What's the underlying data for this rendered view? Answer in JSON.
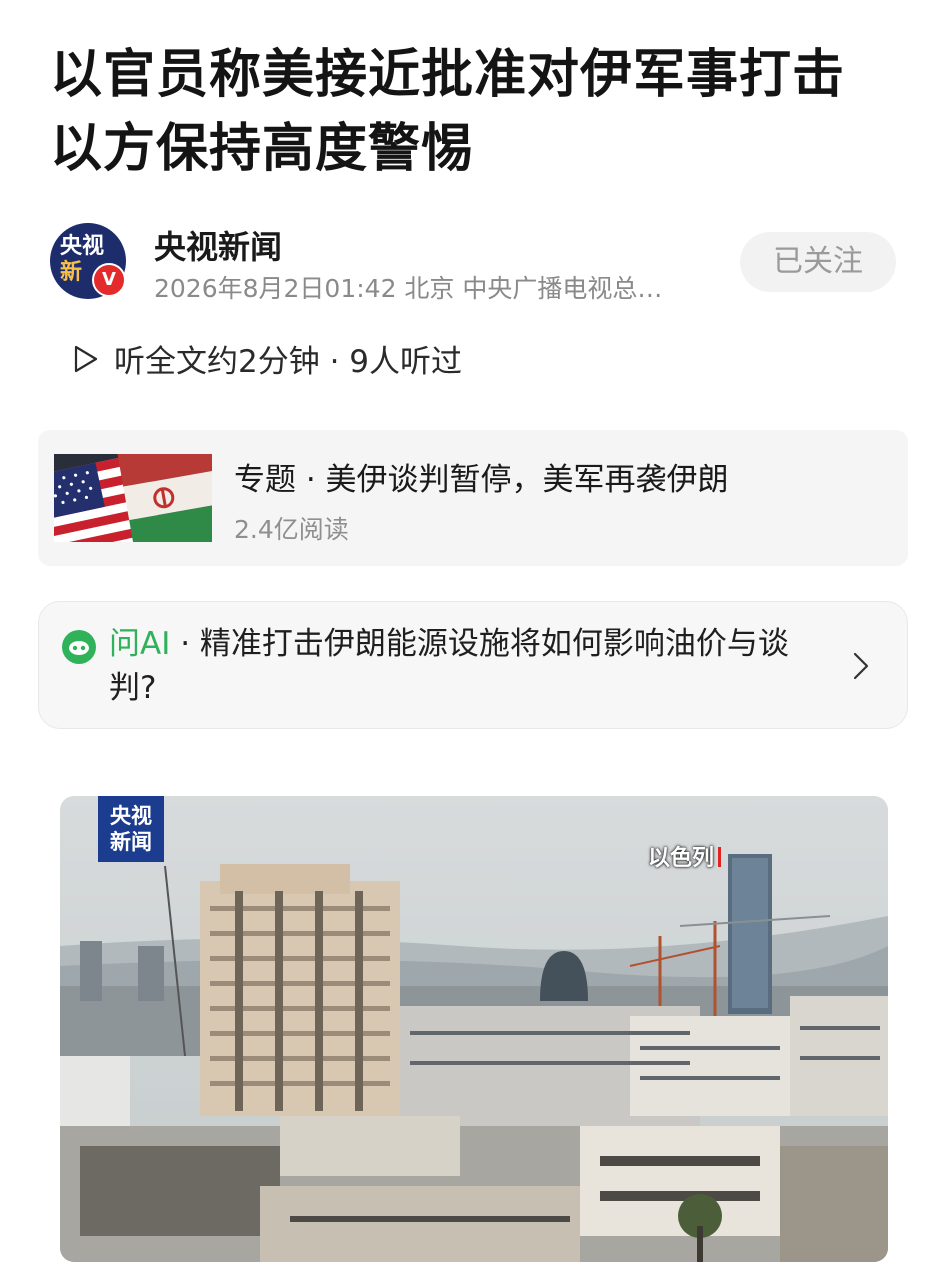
{
  "article": {
    "title": "以官员称美接近批准对伊军事打击以方保持高度警惕"
  },
  "author": {
    "avatar_line1": "央视",
    "avatar_line2": "新",
    "verified_badge": "V",
    "name": "央视新闻",
    "meta": "2026年8月2日01:42 北京 中央广播电视总…",
    "follow_label": "已关注"
  },
  "listen": {
    "icon": "play-icon",
    "text": "听全文约2分钟 · 9人听过"
  },
  "topic": {
    "label": "专题 · 美伊谈判暂停，美军再袭伊朗",
    "reads": "2.4亿阅读",
    "thumbnail": "us-iran-flags"
  },
  "ai": {
    "brand": "问AI",
    "question": " · 精准打击伊朗能源设施将如何影响油价与谈判?",
    "icon": "ai-chat-icon",
    "chevron": "chevron-right-icon"
  },
  "photo": {
    "logo_line1": "央视",
    "logo_line2": "新闻",
    "caption": "以色列"
  },
  "colors": {
    "ai_brand": "#2fb25a",
    "cctv_blue": "#1c3d8f",
    "verified_red": "#e32b2b"
  }
}
